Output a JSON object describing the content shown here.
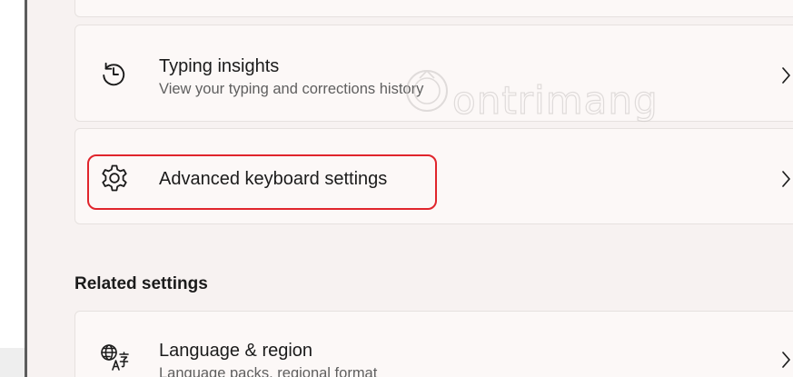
{
  "items": {
    "typing_insights": {
      "title": "Typing insights",
      "subtitle": "View your typing and corrections history"
    },
    "advanced_keyboard": {
      "title": "Advanced keyboard settings"
    },
    "language_region": {
      "title": "Language & region",
      "subtitle": "Language packs, regional format"
    }
  },
  "related_settings": {
    "heading": "Related settings"
  },
  "watermark": {
    "text": "ontrimang"
  },
  "icons": {
    "typing_insights": "history-clock-icon",
    "advanced_keyboard": "gear-icon",
    "language_region": "language-icon",
    "chevron": "chevron-right-icon"
  },
  "colors": {
    "highlight": "#e0252c",
    "card": "#fcf8f7",
    "background": "#f7f2f1"
  }
}
